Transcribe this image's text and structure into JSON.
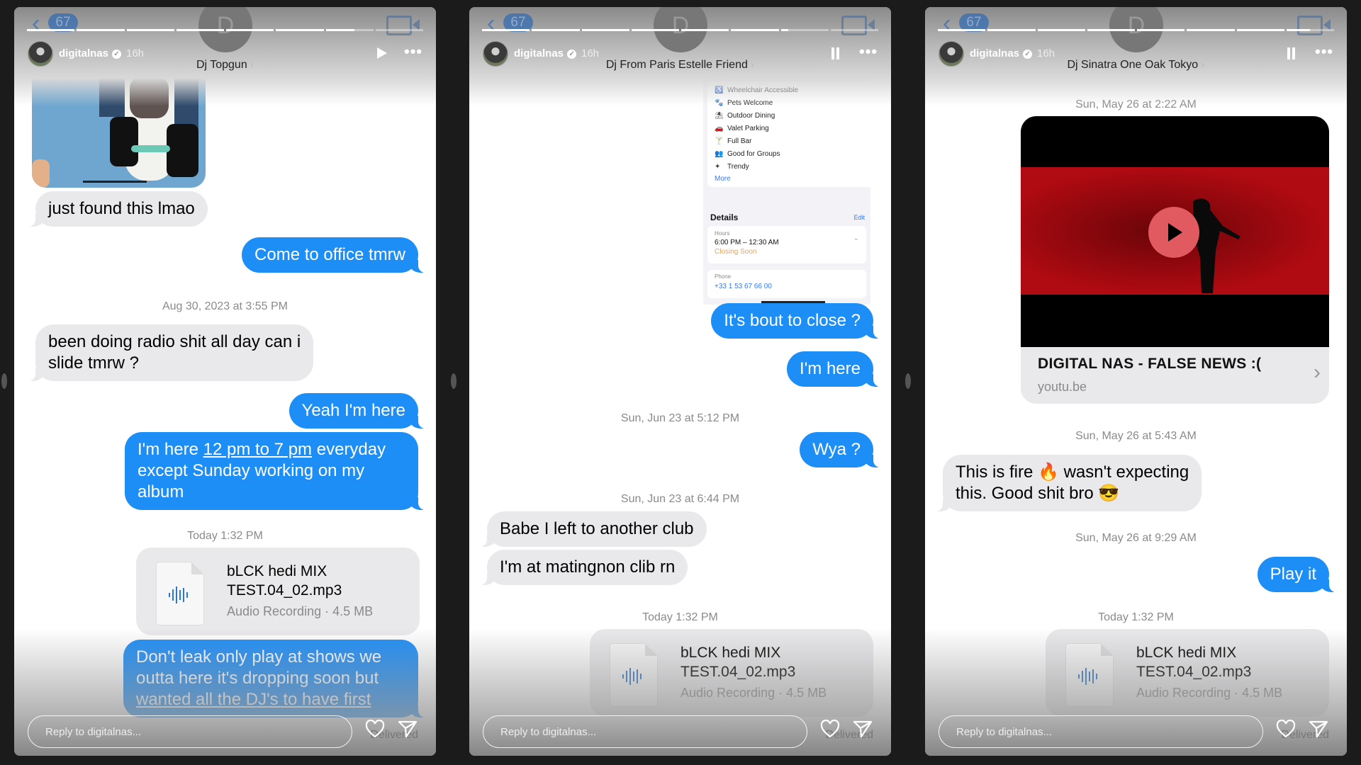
{
  "story_header": {
    "username": "digitalnas",
    "verified": true,
    "time_ago": "16h",
    "back_badge": "67",
    "ghost_avatar_letter": "D",
    "more_icon": "more-horizontal-icon"
  },
  "footer": {
    "reply_placeholder": "Reply to digitalnas...",
    "delivered_label": "Delivered",
    "like_icon": "heart-icon",
    "send_icon": "send-icon"
  },
  "panels": [
    {
      "conversation_title": "Dj Topgun",
      "playback_state": "paused",
      "control_icon": "play-icon",
      "story_progress": {
        "segments": 8,
        "completed": 6,
        "current_fraction": 0.6
      },
      "messages": [
        {
          "type": "image",
          "direction": "in",
          "description": "Photo of feet on skateboard"
        },
        {
          "type": "text",
          "direction": "in",
          "text": "just found this lmao"
        },
        {
          "type": "text",
          "direction": "out",
          "text": "Come to office tmrw"
        },
        {
          "type": "timestamp",
          "text": "Aug 30, 2023 at 3:55 PM"
        },
        {
          "type": "text",
          "direction": "in",
          "lines": [
            "been doing radio shit all day can i",
            "slide tmrw ?"
          ]
        },
        {
          "type": "text",
          "direction": "out",
          "text": "Yeah I'm here"
        },
        {
          "type": "text",
          "direction": "out",
          "pre": "I'm here ",
          "link": "12 pm to 7 pm",
          "post": " everyday",
          "line2": "except Sunday working on my",
          "line3": "album"
        },
        {
          "type": "timestamp",
          "text": "Today 1:32 PM"
        },
        {
          "type": "file",
          "direction": "out",
          "name_line1": "bLCK hedi MIX",
          "name_line2": "TEST.04_02.mp3",
          "meta": "Audio Recording · 4.5 MB"
        },
        {
          "type": "text",
          "direction": "out",
          "lines": [
            "Don't leak only play at shows we",
            "outta here it's dropping soon but",
            "wanted all the DJ's to have first"
          ]
        }
      ]
    },
    {
      "conversation_title": "Dj From Paris Estelle Friend",
      "playback_state": "playing",
      "control_icon": "pause-icon",
      "story_progress": {
        "segments": 8,
        "completed": 6,
        "current_fraction": 0.15
      },
      "screenshot_card": {
        "amenities": [
          {
            "icon": "wheelchair-icon",
            "glyph": "♿",
            "label": "Wheelchair Accessible"
          },
          {
            "icon": "paw-icon",
            "glyph": "🐾",
            "label": "Pets Welcome"
          },
          {
            "icon": "outdoor-dining-icon",
            "glyph": "⛱",
            "label": "Outdoor Dining"
          },
          {
            "icon": "valet-icon",
            "glyph": "🚗",
            "label": "Valet Parking"
          },
          {
            "icon": "cocktail-icon",
            "glyph": "🍸",
            "label": "Full Bar"
          },
          {
            "icon": "group-icon",
            "glyph": "👥",
            "label": "Good for Groups"
          },
          {
            "icon": "trendy-icon",
            "glyph": "✦",
            "label": "Trendy"
          }
        ],
        "more_label": "More",
        "details_heading": "Details",
        "edit_label": "Edit",
        "hours_label": "Hours",
        "hours_value": "6:00 PM – 12:30 AM",
        "hours_status": "Closing Soon",
        "phone_label": "Phone",
        "phone_value": "+33 1 53 67 66 00"
      },
      "messages": [
        {
          "type": "text",
          "direction": "out",
          "text": "It's bout to close ?"
        },
        {
          "type": "text",
          "direction": "out",
          "text": "I'm here"
        },
        {
          "type": "timestamp",
          "text": "Sun, Jun 23 at 5:12 PM"
        },
        {
          "type": "text",
          "direction": "out",
          "text": "Wya ?"
        },
        {
          "type": "timestamp",
          "text": "Sun, Jun 23 at 6:44 PM"
        },
        {
          "type": "text",
          "direction": "in",
          "text": "Babe I left to another club"
        },
        {
          "type": "text",
          "direction": "in",
          "text": "I'm at matingnon clib rn"
        },
        {
          "type": "timestamp",
          "text": "Today 1:32 PM"
        },
        {
          "type": "file",
          "direction": "out",
          "name_line1": "bLCK hedi MIX",
          "name_line2": "TEST.04_02.mp3",
          "meta": "Audio Recording · 4.5 MB"
        }
      ]
    },
    {
      "conversation_title": "Dj Sinatra One Oak Tokyo",
      "playback_state": "playing",
      "control_icon": "pause-icon",
      "story_progress": {
        "segments": 8,
        "completed": 7,
        "current_fraction": 0.5
      },
      "messages": [
        {
          "type": "timestamp",
          "text": "Sun, May 26 at 2:22 AM"
        },
        {
          "type": "link_preview",
          "direction": "out",
          "title": "DIGITAL NAS - FALSE NEWS :(",
          "domain": "youtu.be"
        },
        {
          "type": "timestamp",
          "text": "Sun, May 26 at 5:43 AM"
        },
        {
          "type": "text",
          "direction": "in",
          "lines": [
            "This is fire 🔥 wasn't expecting",
            "this. Good shit bro 😎"
          ]
        },
        {
          "type": "timestamp",
          "text": "Sun, May 26 at 9:29 AM"
        },
        {
          "type": "text",
          "direction": "out",
          "text": "Play it"
        },
        {
          "type": "timestamp",
          "text": "Today 1:32 PM"
        },
        {
          "type": "file",
          "direction": "out",
          "name_line1": "bLCK hedi MIX",
          "name_line2": "TEST.04_02.mp3",
          "meta": "Audio Recording · 4.5 MB"
        }
      ]
    }
  ],
  "colors": {
    "outgoing_bubble": "#1e8ef7",
    "incoming_bubble": "#e9e9eb",
    "timestamp_text": "#8a8a8e",
    "background": "#1b1b1b"
  }
}
